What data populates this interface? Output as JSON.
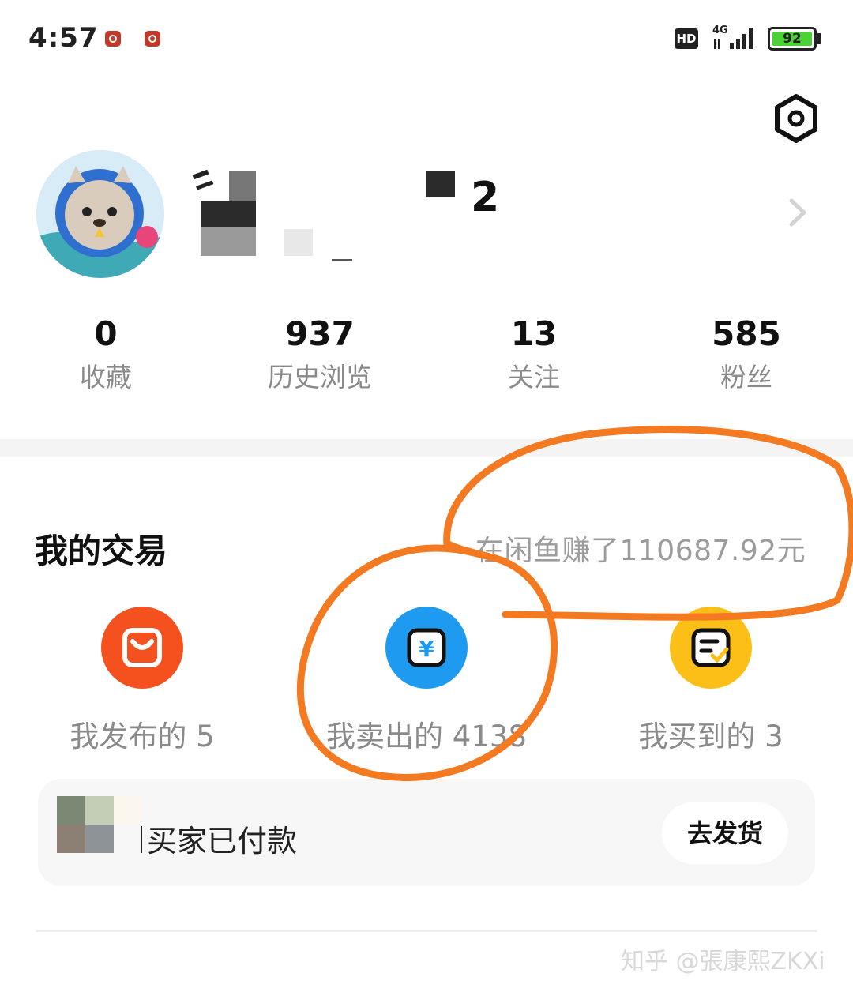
{
  "status_bar": {
    "time": "4:57",
    "hd_label": "HD",
    "network_label": "4G",
    "battery": "92"
  },
  "icons": {
    "settings": "hex-settings-icon",
    "chevron": "chevron-right-icon",
    "publish": "shopping-bag-icon",
    "sold": "yuan-icon",
    "bought": "receipt-check-icon"
  },
  "profile": {
    "name_suffix": "2"
  },
  "stats": [
    {
      "value": "0",
      "label": "收藏"
    },
    {
      "value": "937",
      "label": "历史浏览"
    },
    {
      "value": "13",
      "label": "关注"
    },
    {
      "value": "585",
      "label": "粉丝"
    }
  ],
  "trade": {
    "title": "我的交易",
    "earned_text": "在闲鱼赚了110687.92元",
    "items": [
      {
        "label": "我发布的 5",
        "color": "#f4511e"
      },
      {
        "label": "我卖出的 4138",
        "color": "#1e9bf0"
      },
      {
        "label": "我买到的 3",
        "color": "#fbbf17"
      }
    ]
  },
  "order_card": {
    "status_text": "买家已付款",
    "action_label": "去发货"
  },
  "watermark": "知乎 @張康熙ZKXi",
  "colors": {
    "annotation": "#f47a22",
    "battery_fill": "#4cd137"
  }
}
